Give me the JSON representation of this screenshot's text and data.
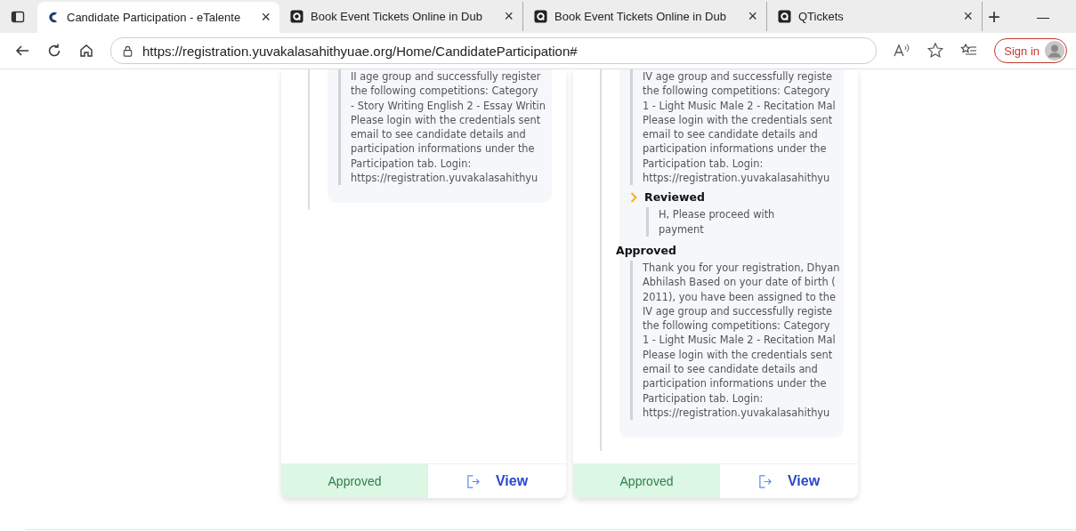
{
  "browser": {
    "tabs": [
      {
        "title": "Candidate Participation - eTalente",
        "selected": true,
        "kind": "brand"
      },
      {
        "title": "Book Event Tickets Online in Dub",
        "selected": false,
        "kind": "q"
      },
      {
        "title": "Book Event Tickets Online in Dub",
        "selected": false,
        "kind": "q"
      },
      {
        "title": "QTickets",
        "selected": false,
        "kind": "q"
      }
    ],
    "close_glyph": "×",
    "new_tab_glyph": "+",
    "minimize_glyph": "—",
    "url": "https://registration.yuvakalasahithyuae.org/Home/CandidateParticipation#",
    "sign_in": "Sign in"
  },
  "cards": [
    {
      "timeline": [
        {
          "kind": "plain",
          "lines": [
            "II age group and successfully register",
            "the following competitions: Category",
            "- Story Writing English 2 - Essay Writin",
            "Please login with the credentials sent",
            "email to see candidate details and",
            "participation informations under the",
            "Participation tab. Login:",
            "https://registration.yuvakalasahithyu"
          ]
        }
      ],
      "footer": {
        "status": "Approved",
        "action": "View"
      }
    },
    {
      "timeline": [
        {
          "kind": "plain",
          "lines": [
            "IV age group and successfully registe",
            "the following competitions: Category",
            "1 - Light Music Male 2 - Recitation Mal",
            "Please login with the credentials sent",
            "email to see candidate details and",
            "participation informations under the",
            "Participation tab. Login:",
            "https://registration.yuvakalasahithyu"
          ]
        },
        {
          "kind": "chevron",
          "status": "Reviewed",
          "lines": [
            "H, Please proceed with",
            "payment"
          ]
        },
        {
          "kind": "heading",
          "status": "Approved",
          "lines": [
            "Thank you for your registration, Dhyan",
            "Abhilash Based on your date of birth (",
            "2011), you have been assigned to the",
            "IV age group and successfully registe",
            "the following competitions: Category",
            "1 - Light Music Male 2 - Recitation Mal",
            "Please login with the credentials sent",
            "email to see candidate details and",
            "participation informations under the",
            "Participation tab. Login:",
            "https://registration.yuvakalasahithyu"
          ]
        }
      ],
      "footer": {
        "status": "Approved",
        "action": "View"
      }
    }
  ]
}
